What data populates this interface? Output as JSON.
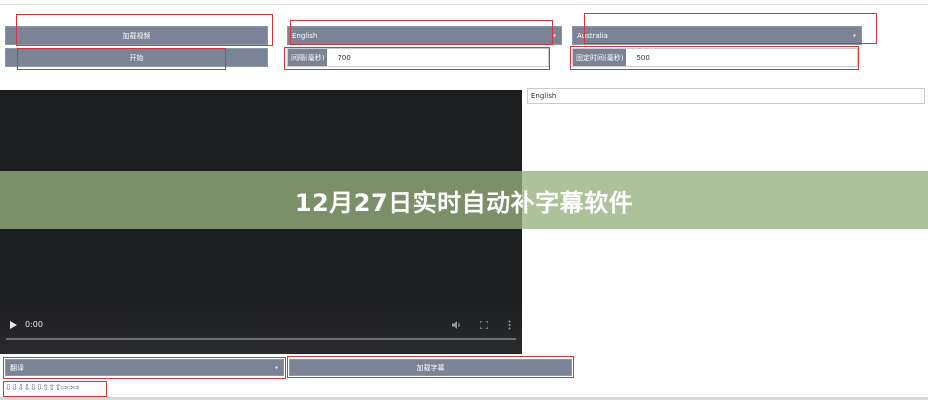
{
  "toolbar": {
    "load_video_label": "加载视频",
    "start_label": "开始",
    "source_language_value": "English",
    "target_language_value": "Australia",
    "interval_label": "间隔(毫秒)",
    "interval_value": "700",
    "fixed_time_label": "固定时间(毫秒)",
    "fixed_time_value": "500",
    "language_input_value": "English"
  },
  "video": {
    "current_time": "0:00",
    "play_icon": "play-icon",
    "volume_icon": "volume-icon",
    "fullscreen_icon": "fullscreen-icon",
    "more_icon": "more-options-icon"
  },
  "banner": {
    "title": "12月27日实时自动补字幕软件"
  },
  "bottom": {
    "translate_select_value": "翻译",
    "load_subtitles_label": "加载字幕",
    "arrow_controls_text": "⇩⇩⇩⇩⇩⇩⇧⇧⇧⇨⇨⇨"
  },
  "colors": {
    "button_bg": "#7b8496",
    "highlight_box": "#d9343c",
    "video_bg": "#1d1e20",
    "banner_bg": "#96af7d"
  }
}
